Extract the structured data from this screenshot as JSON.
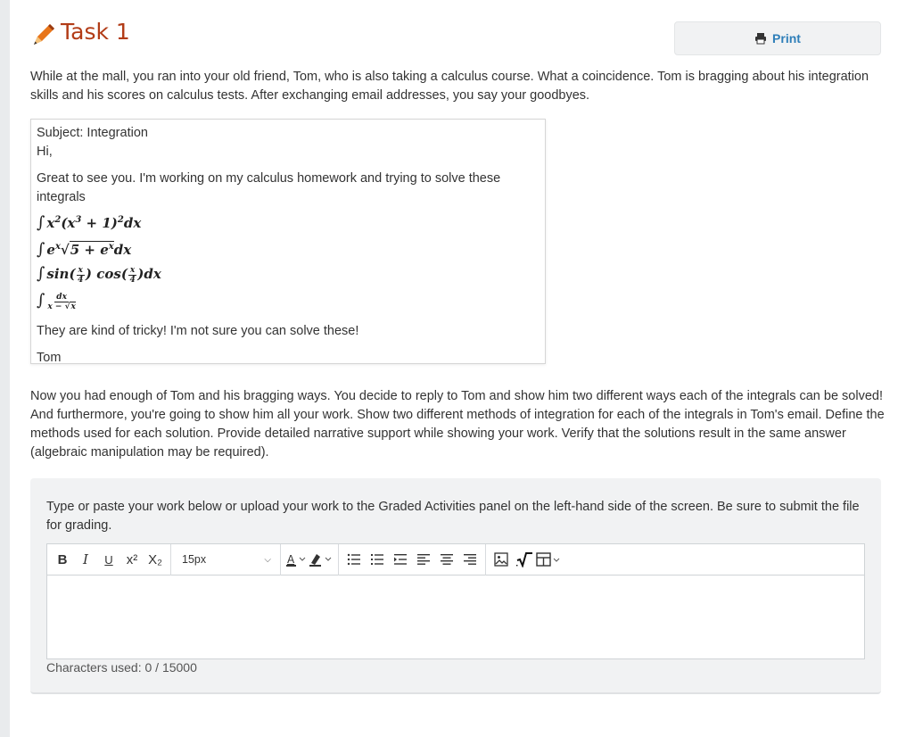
{
  "header": {
    "title": "Task 1",
    "print_label": "Print"
  },
  "intro": "While at the mall, you ran into your old friend, Tom, who is also taking a calculus course. What a coincidence. Tom is bragging about his integration skills and his scores on calculus tests. After exchanging email addresses, you say your goodbyes.",
  "email": {
    "subject": "Subject: Integration",
    "greeting": "Hi,",
    "body": "Great to see you. I'm working on my calculus homework and trying to solve these integrals",
    "closing": "They are kind of tricky! I'm not sure you can solve these!",
    "signature": "Tom",
    "integrals": [
      "∫x²(x³ + 1)²dx",
      "∫eˣ√(5 + eˣ)dx",
      "∫sin(x/4) cos(x/4)dx",
      "∫dx/(x − √x)"
    ]
  },
  "instructions": "Now you had enough of Tom and his bragging ways. You decide to reply to Tom and show him two different ways each of the integrals can be solved! And furthermore, you're going to show him all your work. Show two different methods of integration for each of the integrals in Tom's email. Define the methods used for each solution. Provide detailed narrative support while showing your work. Verify that the solutions result in the same answer (algebraic manipulation may be required).",
  "submission": {
    "prompt": "Type or paste your work below or upload your work to the Graded Activities panel on the left-hand side of the screen. Be sure to submit the file for grading.",
    "font_size": "15px",
    "char_count": "Characters used: 0 / 15000"
  },
  "toolbar": {
    "bold": "B",
    "italic": "I",
    "underline": "U",
    "superscript": "x²",
    "subscript": "X₂"
  },
  "colors": {
    "title": "#b23c17",
    "print": "#2f7fb9",
    "panel_bg": "#f1f2f3"
  }
}
